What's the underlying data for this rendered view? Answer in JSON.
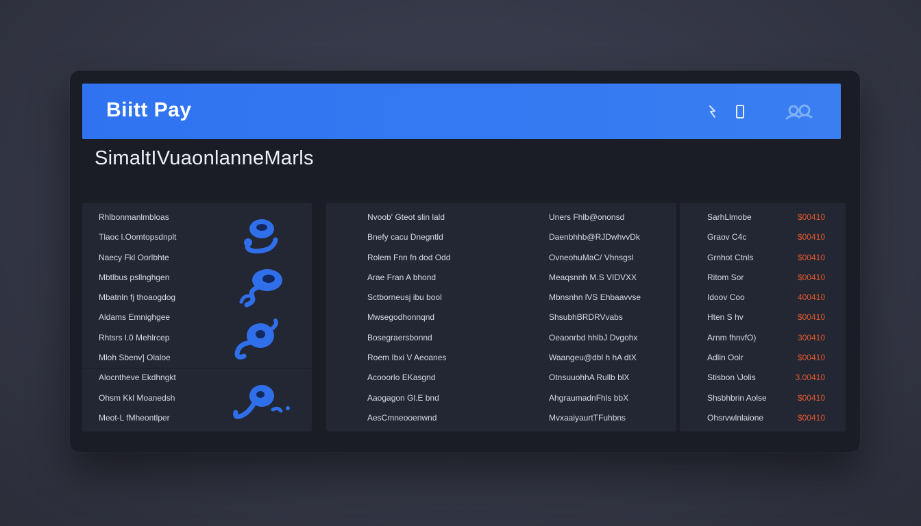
{
  "app": {
    "brand": "Biitt Pay",
    "title": "SimaltIVuaonlanneMarls"
  },
  "header_icons": [
    "wand-icon",
    "phone-icon",
    "users-icon"
  ],
  "colors": {
    "accent": "#2f73f1",
    "panel": "#232733",
    "window": "#1a1d26",
    "amount": "#e2582f"
  },
  "left_panel": {
    "items": [
      "Rhlbonmanlmbloas",
      "Tlaoc l.Oomtopsdnplt",
      "Naecy Fkl Oorlbhte",
      "Mbtlbus psllnghgen",
      "Mbatnln fj thoaogdog",
      "Aldams Emnighgee",
      "Rhtsrs l.0 Mehlrcep",
      "Mloh Sbenv] Olaloe",
      "Alocntheve Ekdhngkt",
      "Ohsm Kkl Moanedsh",
      "Meot-L fMheontlper"
    ]
  },
  "middle_panel": {
    "col_a": [
      "Nvoob' Gteot slin lald",
      "Bnefy cacu Dnegntld",
      "Rolem Fnn fn dod Odd",
      "Arae Fran A bhond",
      "Sctborneusj ibu bool",
      "Mwsegodhonnqnd",
      "Bosegraersbonnd",
      "Roem Ibxi V Aeoanes",
      "Acooorlo EKasgnd",
      "Aaogagon Gl.E bnd",
      "AesCmneooenwnd"
    ],
    "col_b": [
      "Uners Fhlb@ononsd",
      "Daenbhhb@RJDwhvvDk",
      "OvneohuMaC/ Vhnsgsl",
      "Meaqsnnh M.S VIDVXX",
      "Mbnsnhn lVS Ehbaavvse",
      "ShsubhBRDRVvabs",
      "Oeaonrbd hhlbJ Dvgohx",
      "Waangeu@dbl h hA dtX",
      "OtnsuuohhA Rullb blX",
      "AhgraumadnFhls bbX",
      "MvxaaiyaurtTFuhbns"
    ]
  },
  "right_panel": {
    "names": [
      "SarhLlmobe",
      "Graov C4c",
      "Grnhot Ctnls",
      "Ritom Sor",
      "Idoov Coo",
      "Hten S hv",
      "Arnm fhnvfO)",
      "Adlin Oolr",
      "Stisbon \\Jolis",
      "Shsbhbrin Aolse",
      "Ohsrvwlnlaione"
    ],
    "amounts": [
      "$00410",
      "$00410",
      "$00410",
      "$00410",
      "400410",
      "$00410",
      "300410",
      "$00410",
      "3.00410",
      "$00410",
      "$00410"
    ]
  }
}
